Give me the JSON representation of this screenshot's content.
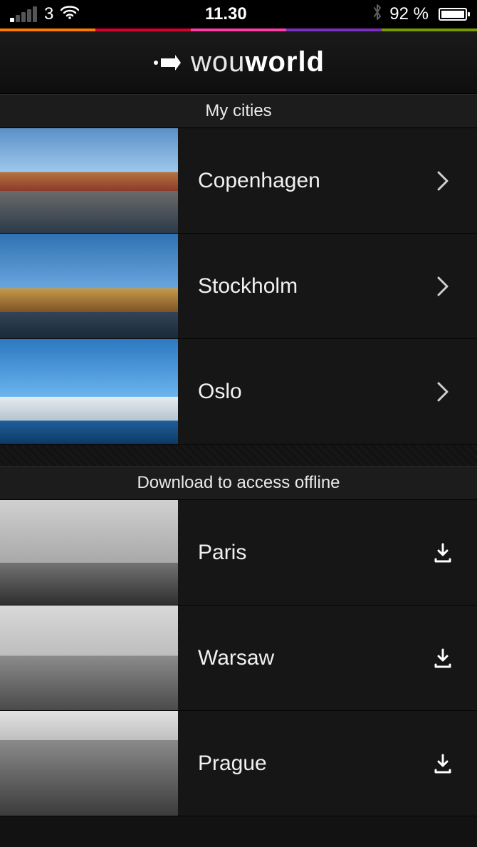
{
  "status_bar": {
    "carrier": "3",
    "time": "11.30",
    "battery_pct": "92 %"
  },
  "app_title": {
    "brand_light": "wou",
    "brand_bold": "world"
  },
  "sections": {
    "my_cities_header": "My cities",
    "download_header": "Download to access offline"
  },
  "my_cities": [
    {
      "name": "Copenhagen",
      "thumb": "copenhagen",
      "action": "open"
    },
    {
      "name": "Stockholm",
      "thumb": "stockholm",
      "action": "open"
    },
    {
      "name": "Oslo",
      "thumb": "oslo",
      "action": "open"
    }
  ],
  "download_cities": [
    {
      "name": "Paris",
      "thumb": "paris",
      "action": "download"
    },
    {
      "name": "Warsaw",
      "thumb": "warsaw",
      "action": "download"
    },
    {
      "name": "Prague",
      "thumb": "prague",
      "action": "download"
    }
  ],
  "icons": {
    "arrow_logo": "arrow-right-icon",
    "chevron": "chevron-right-icon",
    "download": "download-icon",
    "wifi": "wifi-icon",
    "bluetooth": "bluetooth-icon",
    "battery": "battery-icon"
  }
}
